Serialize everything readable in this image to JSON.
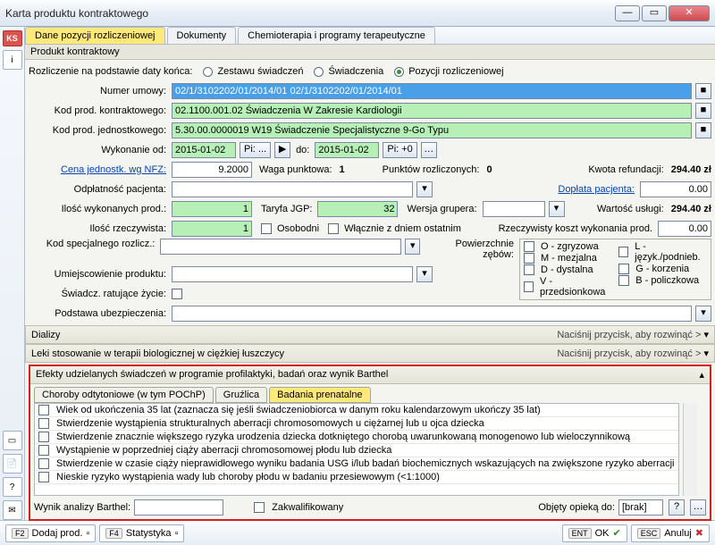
{
  "window": {
    "title": "Karta produktu kontraktowego"
  },
  "tabs": {
    "t1": "Dane pozycji rozliczeniowej",
    "t2": "Dokumenty",
    "t3": "Chemioterapia i programy terapeutyczne"
  },
  "section1": "Produkt kontraktowy",
  "settlement": {
    "label": "Rozliczenie na podstawie daty końca:",
    "opt1": "Zestawu świadczeń",
    "opt2": "Świadczenia",
    "opt3": "Pozycji rozliczeniowej"
  },
  "labels": {
    "umowa": "Numer umowy:",
    "kodKontr": "Kod prod. kontraktowego:",
    "kodJedn": "Kod prod. jednostkowego:",
    "wykonanie": "Wykonanie od:",
    "wykonanieDo": "do:",
    "cenaNFZ": "Cena jednostk. wg NFZ:",
    "waga": "Waga punktowa:",
    "punkty": "Punktów rozliczonych:",
    "kwota": "Kwota refundacji:",
    "odplatnosc": "Odpłatność pacjenta:",
    "doplata": "Dopłata pacjenta:",
    "iloscWyk": "Ilość wykonanych prod.:",
    "taryfa": "Taryfa JGP:",
    "wersjaGr": "Wersja grupera:",
    "wartosc": "Wartość usługi:",
    "iloscRz": "Ilość rzeczywista:",
    "osobodni": "Osobodni",
    "wlacznie": "Włącznie z dniem ostatnim",
    "rzeczKoszt": "Rzeczywisty koszt wykonania prod.",
    "kodSpec": "Kod specjalnego rozlicz.:",
    "powZebow": "Powierzchnie zębów:",
    "umiejsc": "Umiejscowienie produktu:",
    "swiadRat": "Świadcz. ratujące życie:",
    "podstUbez": "Podstawa ubezpieczenia:"
  },
  "values": {
    "umowa": "02/1/3102202/01/2014/01 02/1/3102202/01/2014/01",
    "kodKontr": "02.1100.001.02 Świadczenia W Zakresie Kardiologii",
    "kodJedn": "5.30.00.0000019 W19 Świadczenie Specjalistyczne 9-Go Typu",
    "dateFrom": "2015-01-02",
    "pi1": "Pi: ...",
    "dateTo": "2015-01-02",
    "pi2": "Pi: +0",
    "cenaNFZ": "9.2000",
    "waga": "1",
    "punkty": "0",
    "kwota": "294.40 zł",
    "doplata": "0.00",
    "iloscWyk": "1",
    "taryfa": "32",
    "wartosc": "294.40 zł",
    "iloscRz": "1",
    "rzeczKoszt": "0.00"
  },
  "tooth": {
    "o": "O - zgryzowa",
    "m": "M - mezjalna",
    "d": "D - dystalna",
    "v": "V - przedsionkowa",
    "l": "L - język./podnieb.",
    "g": "G - korzenia",
    "b": "B - policzkowa"
  },
  "collapse": {
    "dializy": "Dializy",
    "leki": "Leki stosowanie w terapii biologicznej w ciężkiej łuszczycy",
    "hint": "Naciśnij przycisk, aby rozwinąć >"
  },
  "redbox": {
    "title": "Efekty udzielanych świadczeń w programie profilaktyki, badań oraz wynik Barthel",
    "subtabs": {
      "t1": "Choroby odtytoniowe (w tym POChP)",
      "t2": "Gruźlica",
      "t3": "Badania prenatalne"
    },
    "items": [
      "Wiek od ukończenia 35 lat (zaznacza się jeśli świadczeniobiorca w danym roku kalendarzowym ukończy 35 lat)",
      "Stwierdzenie wystąpienia strukturalnych aberracji chromosomowych u ciężarnej lub u ojca dziecka",
      "Stwierdzenie znacznie większego ryzyka urodzenia dziecka dotkniętego chorobą uwarunkowaną monogenowo lub wieloczynnikową",
      "Wystąpienie w poprzedniej ciąży aberracji chromosomowej płodu lub dziecka",
      "Stwierdzenie w czasie ciąży nieprawidłowego wyniku badania USG i/lub badań biochemicznych wskazujących na zwiększone ryzyko aberracji",
      "Nieskie ryzyko wystąpienia wady lub choroby płodu w badaniu przesiewowym (<1:1000)"
    ],
    "barthel": "Wynik analizy Barthel:",
    "zakw": "Zakwalifikowany",
    "objety": "Objęty opieką do:",
    "brak": "[brak]"
  },
  "status": {
    "f2": "Dodaj prod.",
    "f4": "Statystyka",
    "ok": "OK",
    "cancel": "Anuluj"
  }
}
